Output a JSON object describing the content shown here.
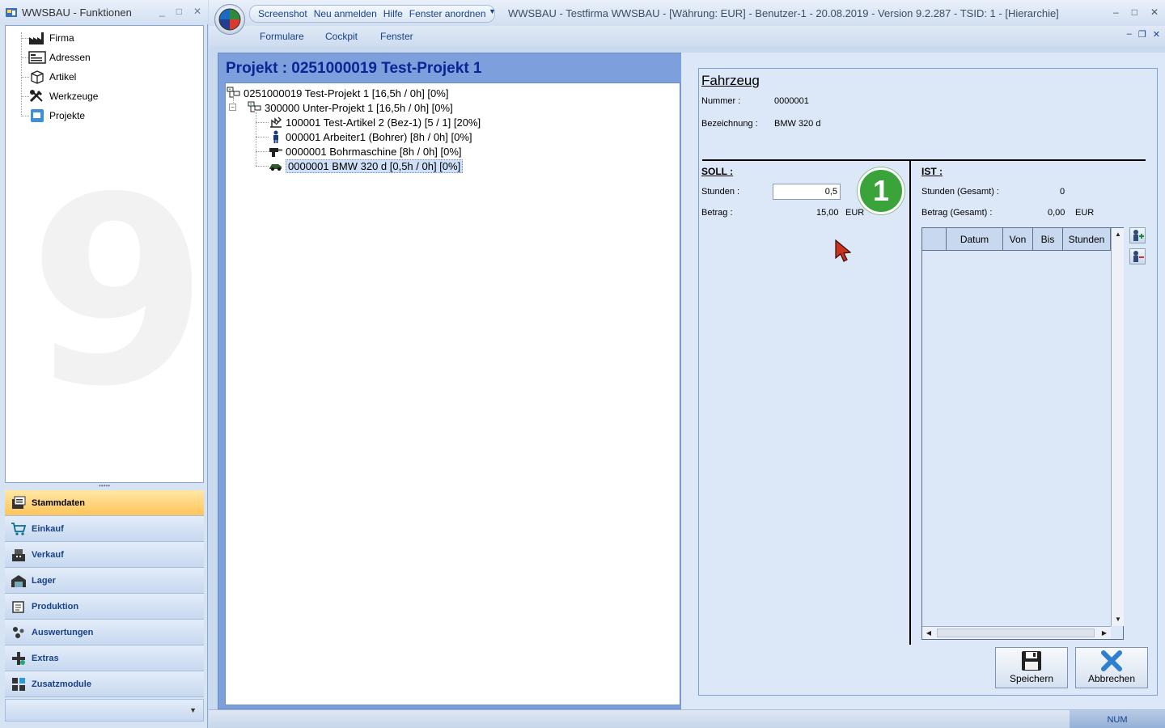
{
  "left_window": {
    "title": "WWSBAU - Funktionen",
    "tree": [
      {
        "label": "Firma",
        "icon": "factory-icon"
      },
      {
        "label": "Adressen",
        "icon": "address-card-icon"
      },
      {
        "label": "Artikel",
        "icon": "box-icon"
      },
      {
        "label": "Werkzeuge",
        "icon": "tools-icon"
      },
      {
        "label": "Projekte",
        "icon": "project-icon"
      }
    ],
    "nav": [
      {
        "label": "Stammdaten",
        "active": true
      },
      {
        "label": "Einkauf"
      },
      {
        "label": "Verkauf"
      },
      {
        "label": "Lager"
      },
      {
        "label": "Produktion"
      },
      {
        "label": "Auswertungen"
      },
      {
        "label": "Extras"
      },
      {
        "label": "Zusatzmodule"
      }
    ]
  },
  "main_window": {
    "quick_access": [
      "Screenshot",
      "Neu anmelden",
      "Hilfe",
      "Fenster anordnen"
    ],
    "title": "WWSBAU - Testfirma WWSBAU - [Währung: EUR] - Benutzer-1 - 20.08.2019 - Version 9.2.287 - TSID: 1  - [Hierarchie]",
    "menu": [
      "Formulare",
      "Cockpit",
      "Fenster"
    ]
  },
  "project": {
    "header": "Projekt :  0251000019  Test-Projekt 1",
    "tree": [
      {
        "text": "0251000019  Test-Projekt 1  [16,5h / 0h]  [0%]"
      },
      {
        "text": "300000  Unter-Projekt 1  [16,5h / 0h]  [0%]"
      },
      {
        "text": "100001  Test-Artikel 2  (Bez-1)  [5 / 1]  [20%]"
      },
      {
        "text": "000001  Arbeiter1 (Bohrer)  [8h / 0h]  [0%]"
      },
      {
        "text": "0000001  Bohrmaschine  [8h / 0h]  [0%]"
      },
      {
        "text": "0000001  BMW 320 d  [0,5h / 0h]  [0%]",
        "selected": true
      }
    ]
  },
  "detail": {
    "title": "Fahrzeug",
    "nummer_label": "Nummer :",
    "nummer_value": "0000001",
    "bezeichnung_label": "Bezeichnung :",
    "bezeichnung_value": "BMW 320 d",
    "soll_head": "SOLL :",
    "stunden_label": "Stunden :",
    "stunden_value": "0,5",
    "betrag_label": "Betrag :",
    "betrag_value": "15,00",
    "betrag_currency": "EUR",
    "ist_head": "IST :",
    "ist_stunden_label": "Stunden (Gesamt) :",
    "ist_stunden_value": "0",
    "ist_betrag_label": "Betrag (Gesamt) :",
    "ist_betrag_value": "0,00",
    "ist_betrag_currency": "EUR",
    "grid_columns": [
      "",
      "Datum",
      "Von",
      "Bis",
      "Stunden"
    ],
    "badge": "1",
    "save_label": "Speichern",
    "cancel_label": "Abbrechen"
  },
  "status": {
    "num": "NUM"
  }
}
